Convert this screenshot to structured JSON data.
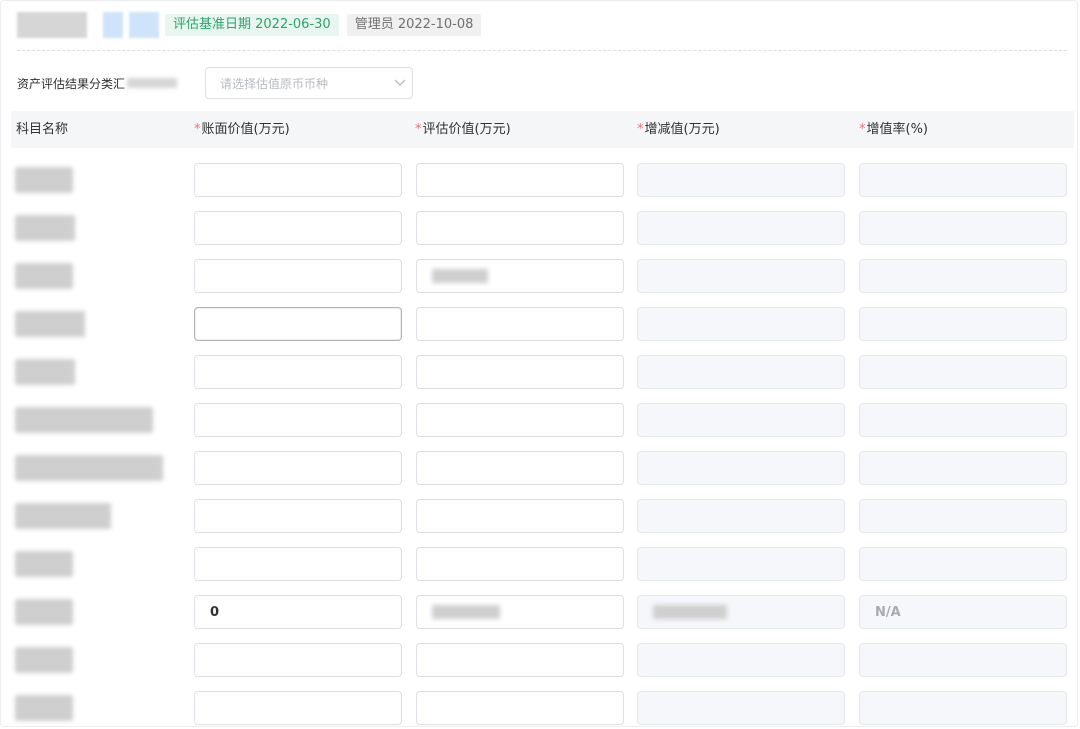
{
  "header": {
    "eval_date_tag": "评估基准日期 2022-06-30",
    "admin_tag": "管理员 2022-10-08"
  },
  "filter": {
    "label": "资产评估结果分类汇",
    "currency_placeholder": "请选择估值原币币种"
  },
  "table": {
    "columns": [
      {
        "label": "科目名称",
        "required": false
      },
      {
        "label": "账面价值(万元)",
        "required": true
      },
      {
        "label": "评估价值(万元)",
        "required": true
      },
      {
        "label": "增减值(万元)",
        "required": true
      },
      {
        "label": "增值率(%)",
        "required": true
      }
    ],
    "required_mark": "*",
    "row_count": 12,
    "filled_row": {
      "book_value": "0",
      "increase_rate": "N/A"
    }
  },
  "colors": {
    "required": "#f56c6c",
    "tag_green_text": "#2ea36c",
    "tag_green_bg": "#e7f6ef",
    "header_bg": "#f5f6f8",
    "readonly_bg": "#f5f7fa"
  }
}
